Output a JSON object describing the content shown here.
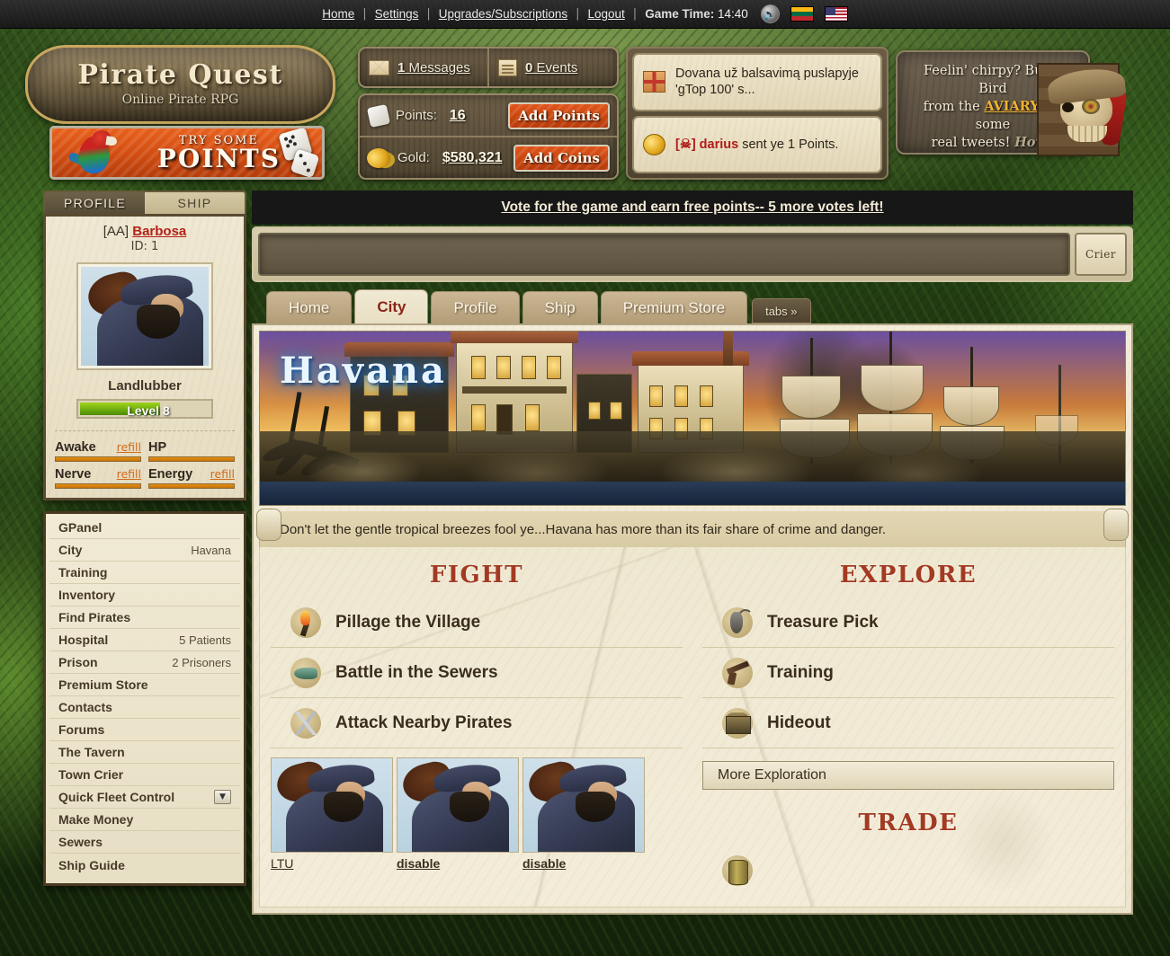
{
  "topnav": {
    "links": [
      "Home",
      "Settings",
      "Upgrades/Subscriptions",
      "Logout"
    ],
    "sep": "|",
    "game_time_label": "Game Time:",
    "game_time_value": "14:40",
    "sound_icon": "sound-on-icon",
    "flags": [
      "lithuania-flag",
      "usa-flag"
    ]
  },
  "logo": {
    "title": "Pirate Quest",
    "subtitle": "Online Pirate RPG"
  },
  "points_banner": {
    "try_some": "TRY SOME",
    "points": "POINTS"
  },
  "header": {
    "messages_count": "1",
    "messages_label": "Messages",
    "events_count": "0",
    "events_label": "Events",
    "points_label": "Points:",
    "points_value": "16",
    "add_points_label": "Add Points",
    "gold_label": "Gold:",
    "gold_value": "$580,321",
    "add_coins_label": "Add Coins"
  },
  "notifications": [
    {
      "icon": "gift-icon",
      "text": "Dovana už balsavimą puslapyje 'gTop 100' s..."
    },
    {
      "icon": "coin-icon",
      "prefix": "[☠] darius",
      "text": " sent ye 1 Points."
    }
  ],
  "tip": {
    "line1": "Feelin' chirpy? Buy a Bird",
    "line2_pre": "from the ",
    "aviary": "AVIARY",
    "line2_post": " for some",
    "line3": "real tweets! ",
    "how": "How?"
  },
  "profile": {
    "tabs": [
      {
        "label": "PROFILE",
        "active": true
      },
      {
        "label": "SHIP",
        "active": false
      }
    ],
    "clan_tag": "[AA]",
    "name": "Barbosa",
    "id_label": "ID: 1",
    "rank": "Landlubber",
    "level_text": "Level 8",
    "meters": [
      {
        "name": "Awake",
        "refill": "refill"
      },
      {
        "name": "HP",
        "refill": ""
      },
      {
        "name": "Nerve",
        "refill": "refill"
      },
      {
        "name": "Energy",
        "refill": "refill"
      }
    ]
  },
  "navmenu": [
    {
      "label": "GPanel",
      "meta": ""
    },
    {
      "label": "City",
      "meta": "Havana"
    },
    {
      "label": "Training",
      "meta": ""
    },
    {
      "label": "Inventory",
      "meta": ""
    },
    {
      "label": "Find Pirates",
      "meta": ""
    },
    {
      "label": "Hospital",
      "meta": "5 Patients"
    },
    {
      "label": "Prison",
      "meta": "2 Prisoners"
    },
    {
      "label": "Premium Store",
      "meta": ""
    },
    {
      "label": "Contacts",
      "meta": ""
    },
    {
      "label": "Forums",
      "meta": ""
    },
    {
      "label": "The Tavern",
      "meta": ""
    },
    {
      "label": "Town Crier",
      "meta": ""
    },
    {
      "label": "Quick Fleet Control",
      "meta": "",
      "caret": true
    },
    {
      "label": "Make Money",
      "meta": ""
    },
    {
      "label": "Sewers",
      "meta": ""
    },
    {
      "label": "Ship Guide",
      "meta": ""
    }
  ],
  "vote": {
    "text": "Vote for the game and earn free points-- 5 more votes left!"
  },
  "crier": {
    "input_value": "",
    "placeholder": "",
    "button_label": "Crier"
  },
  "main_tabs": [
    {
      "label": "Home",
      "active": false
    },
    {
      "label": "City",
      "active": true
    },
    {
      "label": "Profile",
      "active": false
    },
    {
      "label": "Ship",
      "active": false
    },
    {
      "label": "Premium Store",
      "active": false
    }
  ],
  "tabs_more_label": "tabs »",
  "city": {
    "banner_title": "Havana",
    "description": "Don't let the gentle tropical breezes fool ye...Havana has more than its fair share of crime and danger."
  },
  "sections": {
    "fight": {
      "title": "FIGHT",
      "items": [
        {
          "icon": "torch-icon",
          "label": "Pillage the Village"
        },
        {
          "icon": "crocodile-icon",
          "label": "Battle in the Sewers"
        },
        {
          "icon": "crossed-swords-icon",
          "label": "Attack Nearby Pirates"
        }
      ]
    },
    "explore": {
      "title": "EXPLORE",
      "items": [
        {
          "icon": "pickaxe-icon",
          "label": "Treasure Pick"
        },
        {
          "icon": "pistol-icon",
          "label": "Training"
        },
        {
          "icon": "treasure-chest-icon",
          "label": "Hideout"
        }
      ],
      "more_label": "More Exploration"
    },
    "trade": {
      "title": "TRADE"
    }
  },
  "thumbnails": [
    {
      "caption": "LTU",
      "bold": false
    },
    {
      "caption": "disable",
      "bold": true
    },
    {
      "caption": "disable",
      "bold": true
    }
  ],
  "colors": {
    "accent_red": "#a33a22",
    "link_red": "#b32118",
    "gold": "#f2b233",
    "orange_button": "#d44e12",
    "parchment": "#efe8d2",
    "level_green": "#6fae0d"
  }
}
